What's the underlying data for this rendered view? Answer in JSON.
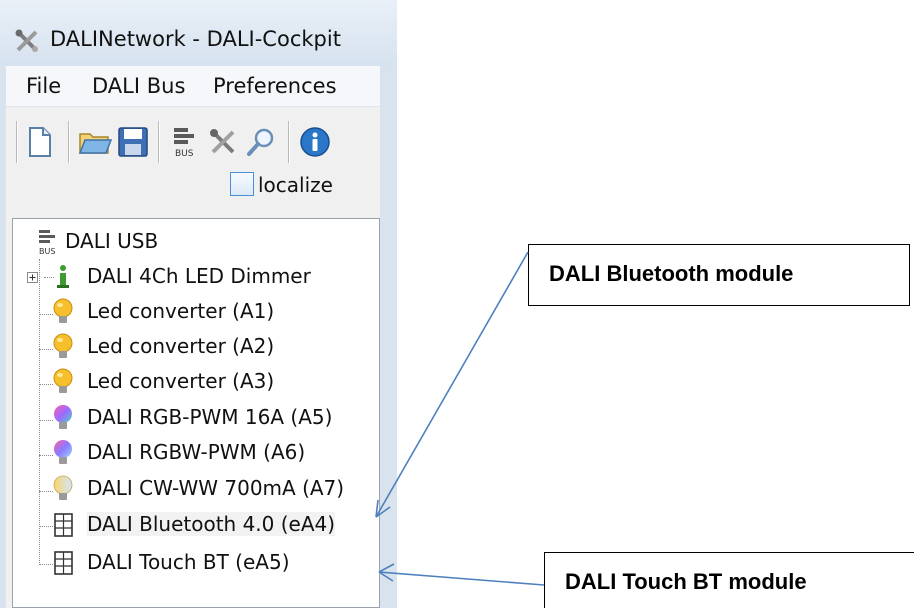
{
  "window": {
    "title": "DALINetwork - DALI-Cockpit",
    "title_icon": "tools-icon"
  },
  "menu": {
    "items": [
      {
        "label": "File"
      },
      {
        "label": "DALI Bus"
      },
      {
        "label": "Preferences"
      }
    ]
  },
  "toolbar": {
    "buttons": [
      "new-document-icon",
      "open-folder-icon",
      "save-icon",
      "bus-icon",
      "tools-icon",
      "search-icon",
      "info-icon"
    ]
  },
  "localize": {
    "label": "localize",
    "checked": false
  },
  "tree": {
    "root": {
      "label": "DALI USB",
      "icon": "bus-icon"
    },
    "items": [
      {
        "label": "DALI 4Ch LED Dimmer",
        "icon": "dimmer-icon",
        "expandable": true
      },
      {
        "label": "Led converter (A1)",
        "icon": "bulb-yellow-icon"
      },
      {
        "label": "Led converter (A2)",
        "icon": "bulb-yellow-icon"
      },
      {
        "label": "Led converter (A3)",
        "icon": "bulb-yellow-icon"
      },
      {
        "label": "DALI RGB-PWM 16A (A5)",
        "icon": "bulb-rgb-icon"
      },
      {
        "label": "DALI RGBW-PWM (A6)",
        "icon": "bulb-rgb-icon"
      },
      {
        "label": "DALI CW-WW 700mA (A7)",
        "icon": "bulb-cwww-icon"
      },
      {
        "label": "DALI Bluetooth 4.0 (eA4)",
        "icon": "input-device-icon",
        "selected": true
      },
      {
        "label": "DALI Touch BT (eA5)",
        "icon": "input-device-icon"
      }
    ]
  },
  "callouts": {
    "bluetooth": "DALI Bluetooth module",
    "touch": "DALI Touch BT module"
  },
  "colors": {
    "arrow": "#4f81bd",
    "checkbox_border": "#4a90d9",
    "bulb_yellow": "#f6c02c"
  }
}
